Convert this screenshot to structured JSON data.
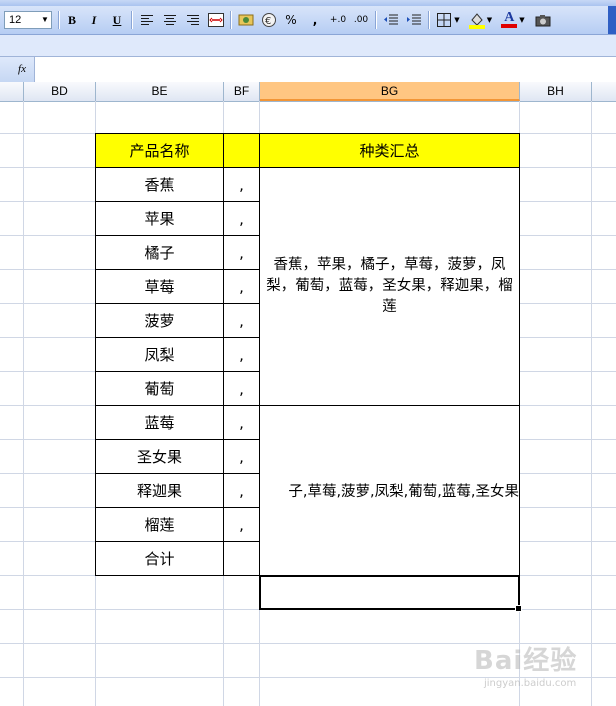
{
  "toolbar": {
    "font_size": "12",
    "bold": "B",
    "italic": "I",
    "underline": "U",
    "percent": "%",
    "comma_style": ",",
    "font_color_letter": "A",
    "increase_decimal": "+.0",
    "decrease_decimal": ".00"
  },
  "formula_bar": {
    "fx_label": "fx"
  },
  "columns": [
    "BD",
    "BE",
    "BF",
    "BG",
    "BH"
  ],
  "selected_column": "BG",
  "table": {
    "header_name": "产品名称",
    "header_summary": "种类汇总",
    "items": [
      "香蕉",
      "苹果",
      "橘子",
      "草莓",
      "菠萝",
      "凤梨",
      "葡萄",
      "蓝莓",
      "圣女果",
      "释迦果",
      "榴莲"
    ],
    "separator": ",",
    "total_label": "合计",
    "summary_text": "香蕉，苹果，橘子，草莓，菠萝，凤梨，葡萄，蓝莓，圣女果，释迦果，榴莲",
    "overflow_text": "子,草莓,菠萝,凤梨,葡萄,蓝莓,圣女果"
  },
  "watermark": {
    "brand": "Bai经验",
    "url": "jingyan.baidu.com"
  },
  "colors": {
    "header_fill": "#ffff00",
    "selected_column_header": "#ffc682",
    "grid_line": "#d0d7e5"
  }
}
